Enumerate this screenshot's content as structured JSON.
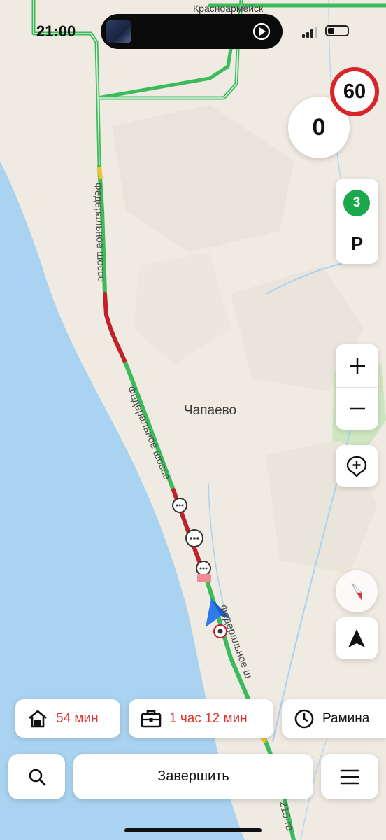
{
  "status_bar": {
    "time": "21:00"
  },
  "map": {
    "city_label": "Красноармейск",
    "village_label": "Чапаево",
    "road_label_1": "Федеральное шоссе",
    "road_label_2": "Федеральное шоссе",
    "road_label_3": "Федеральное ш",
    "road_label_4": "215-га"
  },
  "speed": {
    "limit": "60",
    "current": "0"
  },
  "parking": {
    "count": "3",
    "label": "P"
  },
  "quick_routes": [
    {
      "icon": "home-icon",
      "label": "54 мин",
      "color": "#e0332f"
    },
    {
      "icon": "briefcase-icon",
      "label": "1 час 12 мин",
      "color": "#e0332f"
    },
    {
      "icon": "clock-icon",
      "label": "Рамина",
      "color": "#111111"
    }
  ],
  "bottom_bar": {
    "finish_label": "Завершить"
  },
  "colors": {
    "water": "#a9d3f0",
    "land": "#efeae2",
    "traffic_green": "#3dbb5b",
    "traffic_red": "#c0222c",
    "speed_limit_ring": "#d9252a"
  }
}
